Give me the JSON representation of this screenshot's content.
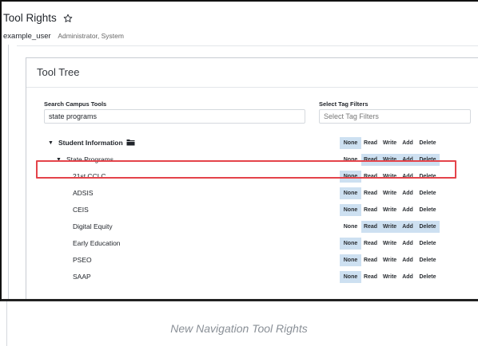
{
  "header": {
    "title": "Tool Rights",
    "username": "example_user",
    "roles": "Administrator, System"
  },
  "panel": {
    "title": "Tool Tree"
  },
  "search": {
    "label": "Search Campus Tools",
    "value": "state programs"
  },
  "tags": {
    "label": "Select Tag Filters",
    "placeholder": "Select Tag Filters"
  },
  "permission_labels": [
    "None",
    "Read",
    "Write",
    "Add",
    "Delete"
  ],
  "tree": [
    {
      "label": "Student Information",
      "bold": true,
      "caret": "▼",
      "folder": true,
      "level": 0,
      "active": [
        "None"
      ]
    },
    {
      "label": "State Programs",
      "bold": false,
      "caret": "▼",
      "folder": false,
      "level": 1,
      "active": [
        "Read",
        "Write",
        "Add",
        "Delete"
      ]
    },
    {
      "label": "21st CCLC",
      "level": 2,
      "active": [
        "None"
      ]
    },
    {
      "label": "ADSIS",
      "level": 2,
      "active": [
        "None"
      ]
    },
    {
      "label": "CEIS",
      "level": 2,
      "active": [
        "None"
      ]
    },
    {
      "label": "Digital Equity",
      "level": 2,
      "active": [
        "Read",
        "Write",
        "Add",
        "Delete"
      ],
      "highlighted": true
    },
    {
      "label": "Early Education",
      "level": 2,
      "active": [
        "None"
      ]
    },
    {
      "label": "PSEO",
      "level": 2,
      "active": [
        "None"
      ]
    },
    {
      "label": "SAAP",
      "level": 2,
      "active": [
        "None"
      ]
    }
  ],
  "caption": "New Navigation Tool Rights",
  "colors": {
    "active_permission": "#cde0f1",
    "highlight_border": "#e4434a"
  },
  "icons": {
    "star": "star-outline-icon",
    "folder": "folder-icon",
    "caret": "caret-down-icon"
  }
}
